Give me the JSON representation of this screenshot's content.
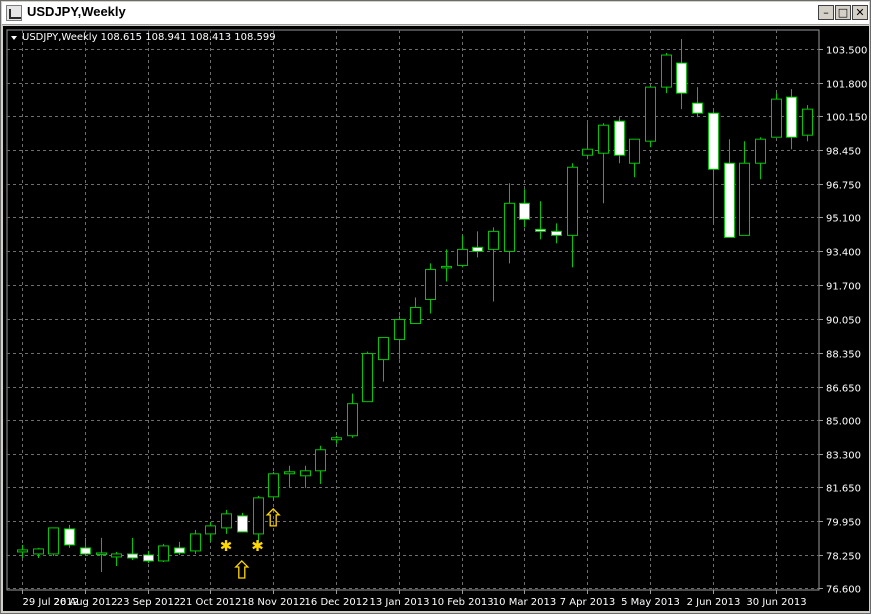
{
  "window": {
    "title": "USDJPY,Weekly",
    "controls": {
      "minimize": "–",
      "maximize": "□",
      "close": "✕"
    }
  },
  "header": {
    "label": "USDJPY,Weekly  108.615 108.941 108.413 108.599"
  },
  "colors": {
    "background": "#000000",
    "grid": "#6e6e6e",
    "bull": "#00c800",
    "bear_body": "#ffffff",
    "marker": "#ffd700",
    "text": "#ffffff"
  },
  "chart_data": {
    "type": "candlestick",
    "symbol": "USDJPY",
    "timeframe": "Weekly",
    "last": {
      "open": 108.615,
      "high": 108.941,
      "low": 108.413,
      "close": 108.599
    },
    "ylim": [
      76.6,
      104.35
    ],
    "yticks": [
      "103.500",
      "101.800",
      "100.150",
      "98.450",
      "96.750",
      "95.100",
      "93.400",
      "91.700",
      "90.050",
      "88.350",
      "86.650",
      "85.000",
      "83.300",
      "81.650",
      "79.950",
      "78.250",
      "76.600"
    ],
    "xtick_labels": [
      "29 Jul 2012",
      "26 Aug 2012",
      "23 Sep 2012",
      "21 Oct 2012",
      "18 Nov 2012",
      "16 Dec 2012",
      "13 Jan 2013",
      "10 Feb 2013",
      "10 Mar 2013",
      "7 Apr 2013",
      "5 May 2013",
      "2 Jun 2013",
      "30 Jun 2013"
    ],
    "xtick_index": [
      0,
      4,
      8,
      12,
      16,
      20,
      24,
      28,
      32,
      36,
      40,
      44,
      48
    ],
    "candles": [
      {
        "o": 78.4,
        "h": 78.75,
        "l": 78.1,
        "c": 78.5
      },
      {
        "o": 78.3,
        "h": 78.6,
        "l": 78.1,
        "c": 78.55
      },
      {
        "o": 78.3,
        "h": 79.6,
        "l": 78.2,
        "c": 79.6
      },
      {
        "o": 79.55,
        "h": 79.75,
        "l": 78.6,
        "c": 78.75
      },
      {
        "o": 78.6,
        "h": 79.1,
        "l": 78.2,
        "c": 78.3
      },
      {
        "o": 78.3,
        "h": 79.1,
        "l": 77.4,
        "c": 78.35
      },
      {
        "o": 78.15,
        "h": 78.4,
        "l": 77.7,
        "c": 78.3
      },
      {
        "o": 78.3,
        "h": 79.1,
        "l": 78.0,
        "c": 78.1
      },
      {
        "o": 78.25,
        "h": 78.45,
        "l": 77.85,
        "c": 77.95
      },
      {
        "o": 77.95,
        "h": 78.8,
        "l": 77.9,
        "c": 78.7
      },
      {
        "o": 78.6,
        "h": 78.9,
        "l": 78.25,
        "c": 78.35
      },
      {
        "o": 78.45,
        "h": 79.5,
        "l": 78.3,
        "c": 79.3
      },
      {
        "o": 79.3,
        "h": 79.9,
        "l": 78.9,
        "c": 79.7
      },
      {
        "o": 79.6,
        "h": 80.5,
        "l": 79.3,
        "c": 80.3
      },
      {
        "o": 80.2,
        "h": 80.35,
        "l": 79.5,
        "c": 79.4
      },
      {
        "o": 79.3,
        "h": 81.2,
        "l": 78.9,
        "c": 81.1
      },
      {
        "o": 81.15,
        "h": 82.4,
        "l": 80.95,
        "c": 82.3
      },
      {
        "o": 82.3,
        "h": 82.7,
        "l": 81.6,
        "c": 82.4
      },
      {
        "o": 82.2,
        "h": 82.7,
        "l": 81.6,
        "c": 82.45
      },
      {
        "o": 82.45,
        "h": 83.7,
        "l": 81.8,
        "c": 83.5
      },
      {
        "o": 84.0,
        "h": 84.2,
        "l": 83.8,
        "c": 84.1
      },
      {
        "o": 84.2,
        "h": 86.3,
        "l": 84.1,
        "c": 85.8
      },
      {
        "o": 85.9,
        "h": 88.4,
        "l": 85.9,
        "c": 88.3
      },
      {
        "o": 88.0,
        "h": 89.1,
        "l": 86.9,
        "c": 89.1
      },
      {
        "o": 89.0,
        "h": 90.2,
        "l": 88.0,
        "c": 90.0
      },
      {
        "o": 89.8,
        "h": 91.1,
        "l": 90.1,
        "c": 90.6
      },
      {
        "o": 91.0,
        "h": 92.8,
        "l": 90.3,
        "c": 92.5
      },
      {
        "o": 92.6,
        "h": 93.5,
        "l": 91.9,
        "c": 92.65
      },
      {
        "o": 92.7,
        "h": 94.2,
        "l": 92.6,
        "c": 93.5
      },
      {
        "o": 93.6,
        "h": 94.4,
        "l": 93.1,
        "c": 93.4
      },
      {
        "o": 93.5,
        "h": 94.6,
        "l": 90.9,
        "c": 94.4
      },
      {
        "o": 93.4,
        "h": 96.8,
        "l": 92.8,
        "c": 95.8
      },
      {
        "o": 95.8,
        "h": 96.5,
        "l": 94.6,
        "c": 95.0
      },
      {
        "o": 94.5,
        "h": 95.9,
        "l": 94.0,
        "c": 94.4
      },
      {
        "o": 94.4,
        "h": 94.8,
        "l": 93.8,
        "c": 94.2
      },
      {
        "o": 94.2,
        "h": 97.8,
        "l": 92.6,
        "c": 97.6
      },
      {
        "o": 98.2,
        "h": 99.8,
        "l": 98.0,
        "c": 98.5
      },
      {
        "o": 98.3,
        "h": 99.8,
        "l": 95.8,
        "c": 99.7
      },
      {
        "o": 99.9,
        "h": 100.1,
        "l": 97.8,
        "c": 98.2
      },
      {
        "o": 97.8,
        "h": 98.9,
        "l": 97.1,
        "c": 99.0
      },
      {
        "o": 98.9,
        "h": 101.6,
        "l": 98.6,
        "c": 101.6
      },
      {
        "o": 101.6,
        "h": 103.3,
        "l": 101.3,
        "c": 103.2
      },
      {
        "o": 102.8,
        "h": 104.0,
        "l": 100.5,
        "c": 101.3
      },
      {
        "o": 100.8,
        "h": 101.6,
        "l": 100.1,
        "c": 100.3
      },
      {
        "o": 100.3,
        "h": 100.4,
        "l": 94.8,
        "c": 97.5
      },
      {
        "o": 97.8,
        "h": 99.0,
        "l": 94.1,
        "c": 94.1
      },
      {
        "o": 94.2,
        "h": 98.9,
        "l": 94.2,
        "c": 97.8
      },
      {
        "o": 97.8,
        "h": 99.1,
        "l": 97.0,
        "c": 99.0
      },
      {
        "o": 99.1,
        "h": 101.3,
        "l": 99.1,
        "c": 101.0
      },
      {
        "o": 101.1,
        "h": 101.5,
        "l": 98.5,
        "c": 99.1
      },
      {
        "o": 99.2,
        "h": 100.7,
        "l": 98.9,
        "c": 100.5
      }
    ],
    "markers": [
      {
        "type": "star",
        "index": 13,
        "price": 78.75
      },
      {
        "type": "up-arrow",
        "index": 14,
        "price": 77.5
      },
      {
        "type": "star",
        "index": 15,
        "price": 78.75
      },
      {
        "type": "up-arrow",
        "index": 16,
        "price": 80.1
      }
    ]
  }
}
